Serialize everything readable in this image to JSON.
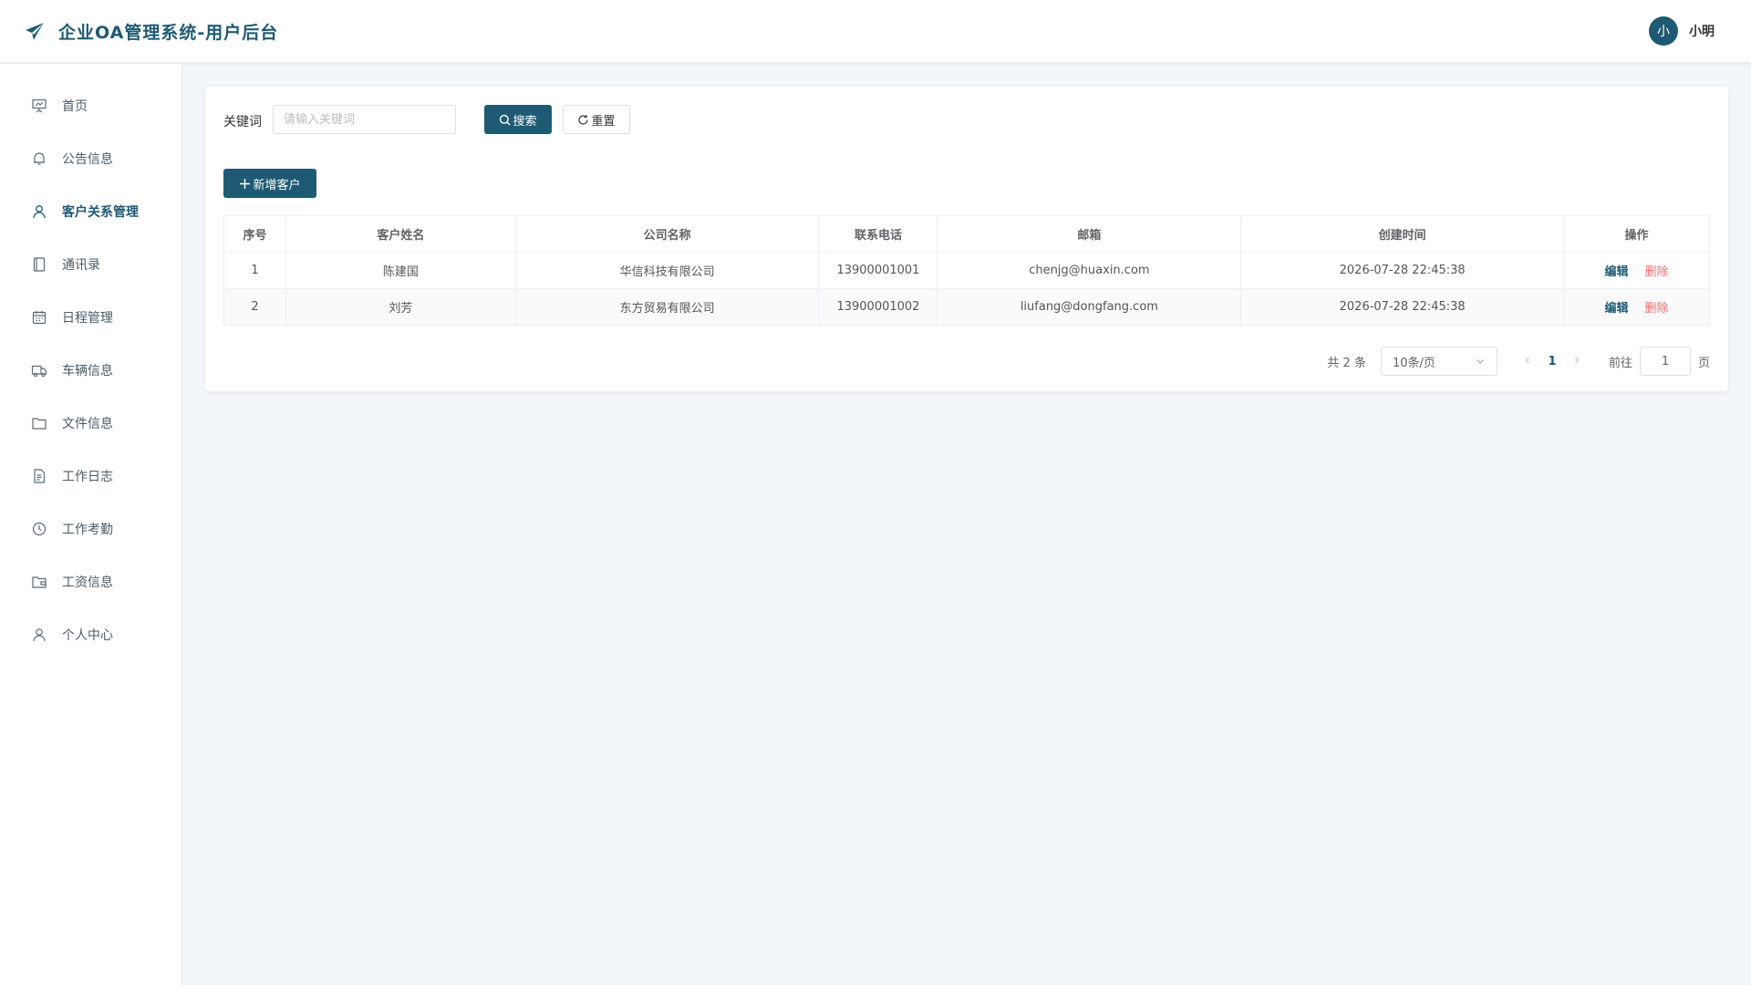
{
  "header": {
    "title": "企业OA管理系统-用户后台",
    "logo_icon": "paper-plane-icon",
    "user": {
      "avatar_text": "小",
      "name": "小明"
    }
  },
  "sidebar": {
    "items": [
      {
        "label": "首页",
        "icon": "presentation-icon",
        "active": false
      },
      {
        "label": "公告信息",
        "icon": "bell-icon",
        "active": false
      },
      {
        "label": "客户关系管理",
        "icon": "user-icon",
        "active": true
      },
      {
        "label": "通讯录",
        "icon": "notebook-icon",
        "active": false
      },
      {
        "label": "日程管理",
        "icon": "calendar-icon",
        "active": false
      },
      {
        "label": "车辆信息",
        "icon": "truck-icon",
        "active": false
      },
      {
        "label": "文件信息",
        "icon": "folder-icon",
        "active": false
      },
      {
        "label": "工作日志",
        "icon": "document-icon",
        "active": false
      },
      {
        "label": "工作考勤",
        "icon": "clock-icon",
        "active": false
      },
      {
        "label": "工资信息",
        "icon": "wallet-folder-icon",
        "active": false
      },
      {
        "label": "个人中心",
        "icon": "person-icon",
        "active": false
      }
    ]
  },
  "search": {
    "label": "关键词",
    "placeholder": "请输入关键词",
    "value": "",
    "search_button": "搜索",
    "reset_button": "重置"
  },
  "toolbar": {
    "add_button": "新增客户"
  },
  "table": {
    "columns": [
      "序号",
      "客户姓名",
      "公司名称",
      "联系电话",
      "邮箱",
      "创建时间",
      "操作"
    ],
    "rows": [
      {
        "index": "1",
        "name": "陈建国",
        "company": "华信科技有限公司",
        "phone": "13900001001",
        "email": "chenjg@huaxin.com",
        "created": "2026-07-28 22:45:38"
      },
      {
        "index": "2",
        "name": "刘芳",
        "company": "东方贸易有限公司",
        "phone": "13900001002",
        "email": "liufang@dongfang.com",
        "created": "2026-07-28 22:45:38"
      }
    ],
    "edit_label": "编辑",
    "delete_label": "删除"
  },
  "pagination": {
    "total_text": "共 2 条",
    "page_size": "10条/页",
    "current_page": "1",
    "goto_label": "前往",
    "goto_value": "1",
    "goto_unit": "页"
  },
  "colors": {
    "primary": "#1e5a73",
    "danger": "#f56c6c",
    "background": "#f3f6f9"
  }
}
